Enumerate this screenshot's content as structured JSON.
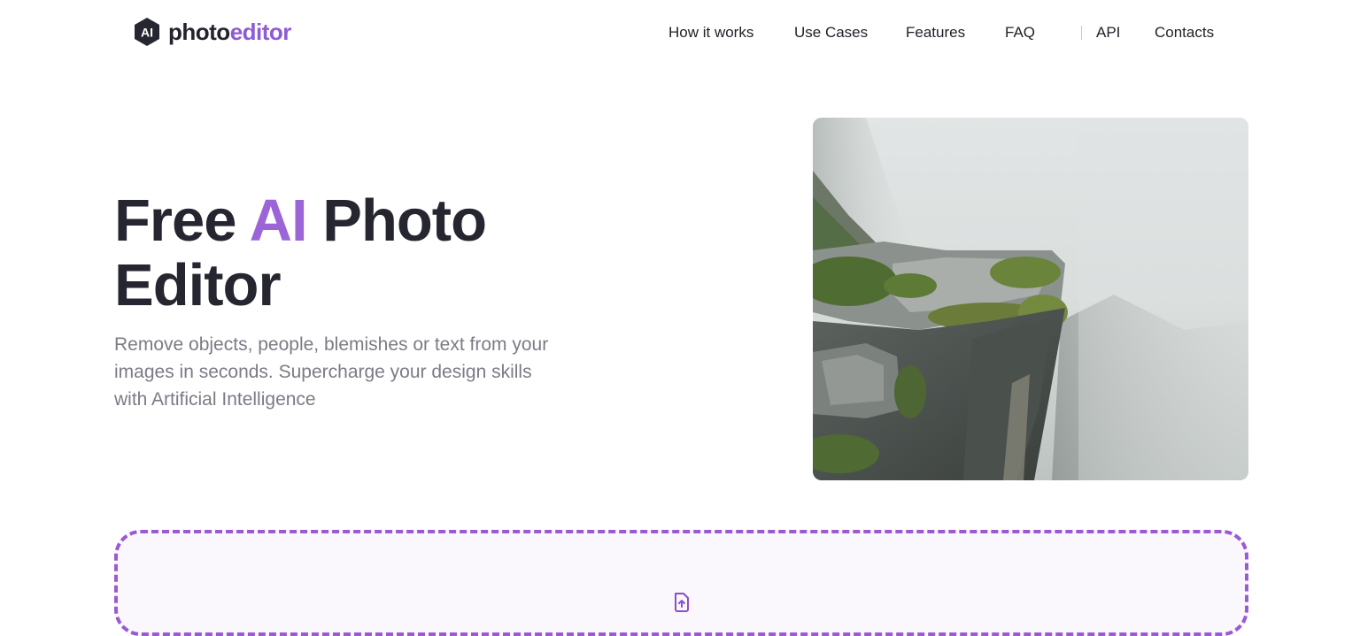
{
  "header": {
    "logo": {
      "badge": "AI",
      "text_primary": "photo",
      "text_accent": "editor"
    },
    "nav": [
      {
        "label": "How it works"
      },
      {
        "label": "Use Cases"
      },
      {
        "label": "Features"
      },
      {
        "label": "FAQ"
      },
      {
        "label": "API"
      },
      {
        "label": "Contacts"
      }
    ]
  },
  "hero": {
    "title_part1": "Free ",
    "title_accent": "AI",
    "title_part2": " Photo",
    "title_line2": "Editor",
    "subtitle": "Remove objects, people, blemishes or text from your images in seconds. Supercharge your design skills with Artificial Intelligence"
  },
  "upload": {
    "icon": "file-upload-icon"
  },
  "colors": {
    "accent": "#9b65d8",
    "text_dark": "#262631",
    "text_muted": "#7b7b86",
    "upload_border": "#9b59d4"
  }
}
